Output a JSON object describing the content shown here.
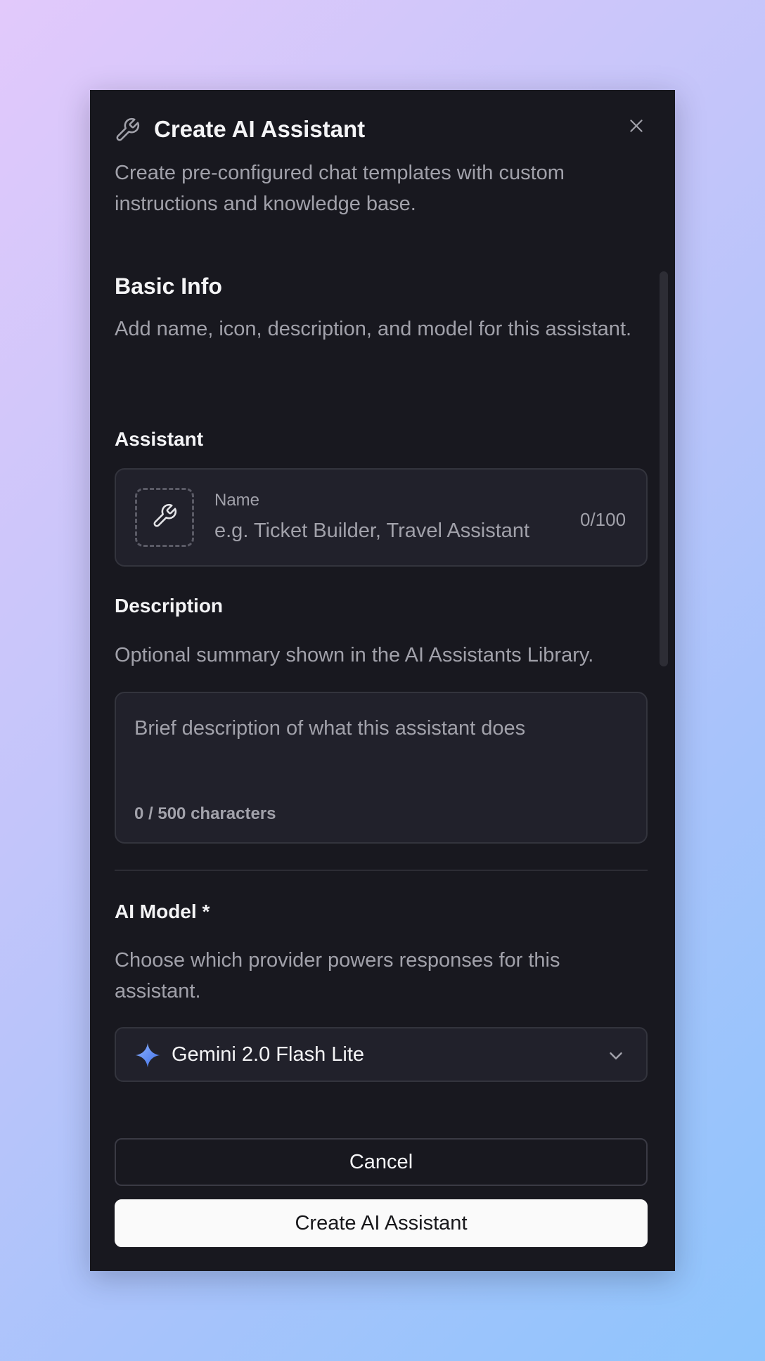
{
  "dialog": {
    "title": "Create AI Assistant",
    "subtitle": "Create pre-configured chat templates with custom instructions and knowledge base.",
    "header_icon": "wrench-icon",
    "close_icon": "close-icon"
  },
  "basic_info": {
    "title": "Basic Info",
    "description": "Add name, icon, description, and model for this assistant."
  },
  "assistant": {
    "label": "Assistant",
    "icon": "wrench-icon",
    "name_label": "Name",
    "name_value": "",
    "name_placeholder": "e.g. Ticket Builder, Travel Assistant",
    "name_counter": "0/100"
  },
  "description": {
    "label": "Description",
    "help": "Optional summary shown in the AI Assistants Library.",
    "value": "",
    "placeholder": "Brief description of what this assistant does",
    "counter": "0 / 500 characters"
  },
  "model": {
    "label": "AI Model *",
    "help": "Choose which provider powers responses for this assistant.",
    "selected": "Gemini 2.0 Flash Lite",
    "icon": "gemini-sparkle-icon",
    "dropdown_icon": "chevron-down-icon"
  },
  "actions": {
    "cancel_label": "Cancel",
    "create_label": "Create AI Assistant"
  },
  "colors": {
    "dialog_bg": "#18181f",
    "field_bg": "#21212b",
    "border": "#33343d",
    "text_primary": "#f4f4f6",
    "text_muted": "#a1a1aa",
    "primary_button_bg": "#fafafa",
    "gemini_blue": "#4a7cf0"
  }
}
